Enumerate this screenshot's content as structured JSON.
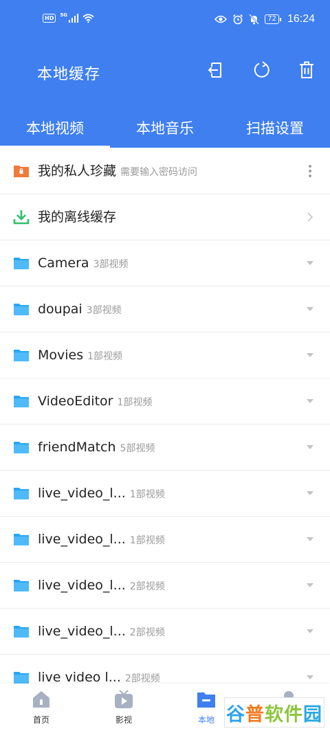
{
  "status_bar": {
    "hd_badge": "HD",
    "network": "5G",
    "battery": "72",
    "time": "16:24"
  },
  "header": {
    "title": "本地缓存",
    "icons": [
      "exit-icon",
      "refresh-icon",
      "trash-icon"
    ]
  },
  "tabs": [
    {
      "label": "本地视频",
      "active": true
    },
    {
      "label": "本地音乐",
      "active": false
    },
    {
      "label": "扫描设置",
      "active": false
    }
  ],
  "private": {
    "name": "我的私人珍藏",
    "sub": "需要输入密码访问"
  },
  "offline": {
    "name": "我的离线缓存"
  },
  "folders": [
    {
      "name": "Camera",
      "count": "3部视频"
    },
    {
      "name": "doupai",
      "count": "3部视频"
    },
    {
      "name": "Movies",
      "count": "1部视频"
    },
    {
      "name": "VideoEditor",
      "count": "1部视频"
    },
    {
      "name": "friendMatch",
      "count": "5部视频"
    },
    {
      "name": "live_video_l...",
      "count": "1部视频"
    },
    {
      "name": "live_video_l...",
      "count": "1部视频"
    },
    {
      "name": "live_video_l...",
      "count": "2部视频"
    },
    {
      "name": "live_video_l...",
      "count": "2部视频"
    },
    {
      "name": "live video l...",
      "count": "2部视频"
    }
  ],
  "bottom_nav": [
    {
      "label": "首页",
      "icon": "home-icon"
    },
    {
      "label": "影视",
      "icon": "tv-icon"
    },
    {
      "label": "本地",
      "icon": "folder-icon",
      "active": true
    },
    {
      "label": "我的",
      "icon": "profile-icon"
    }
  ],
  "watermark": {
    "c1": "谷",
    "c2": "普",
    "c3": "软件",
    "c4": "园"
  },
  "colors": {
    "primary": "#3f7ff0",
    "folder": "#29a6f2",
    "lock": "#f07a3c",
    "download": "#2fbf6a"
  }
}
